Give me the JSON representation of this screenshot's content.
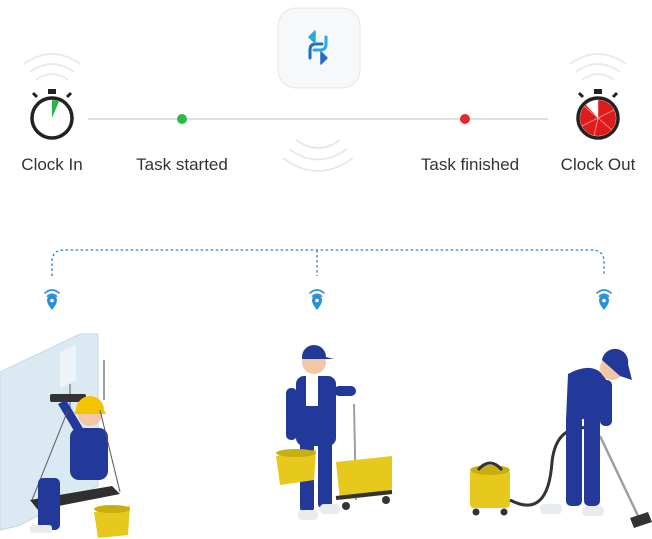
{
  "timeline": {
    "clock_in_label": "Clock In",
    "task_started_label": "Task started",
    "task_finished_label": "Task finished",
    "clock_out_label": "Clock Out"
  },
  "colors": {
    "start_dot": "#2db84a",
    "end_dot": "#e32b2b",
    "clock_out_fill": "#e01b1b",
    "clock_in_wedge": "#2bb24c",
    "connector": "#2a7fc1",
    "uniform": "#23399a",
    "bucket": "#e7c81c",
    "hardhat": "#f2c500"
  },
  "icons": {
    "sync": "sync-arrows-icon",
    "clock_in": "stopwatch-icon",
    "clock_out": "stopwatch-icon",
    "location": "wifi-location-pin-icon"
  },
  "workers": [
    {
      "role": "window-cleaner"
    },
    {
      "role": "cart-cleaner"
    },
    {
      "role": "vacuum-cleaner"
    }
  ]
}
